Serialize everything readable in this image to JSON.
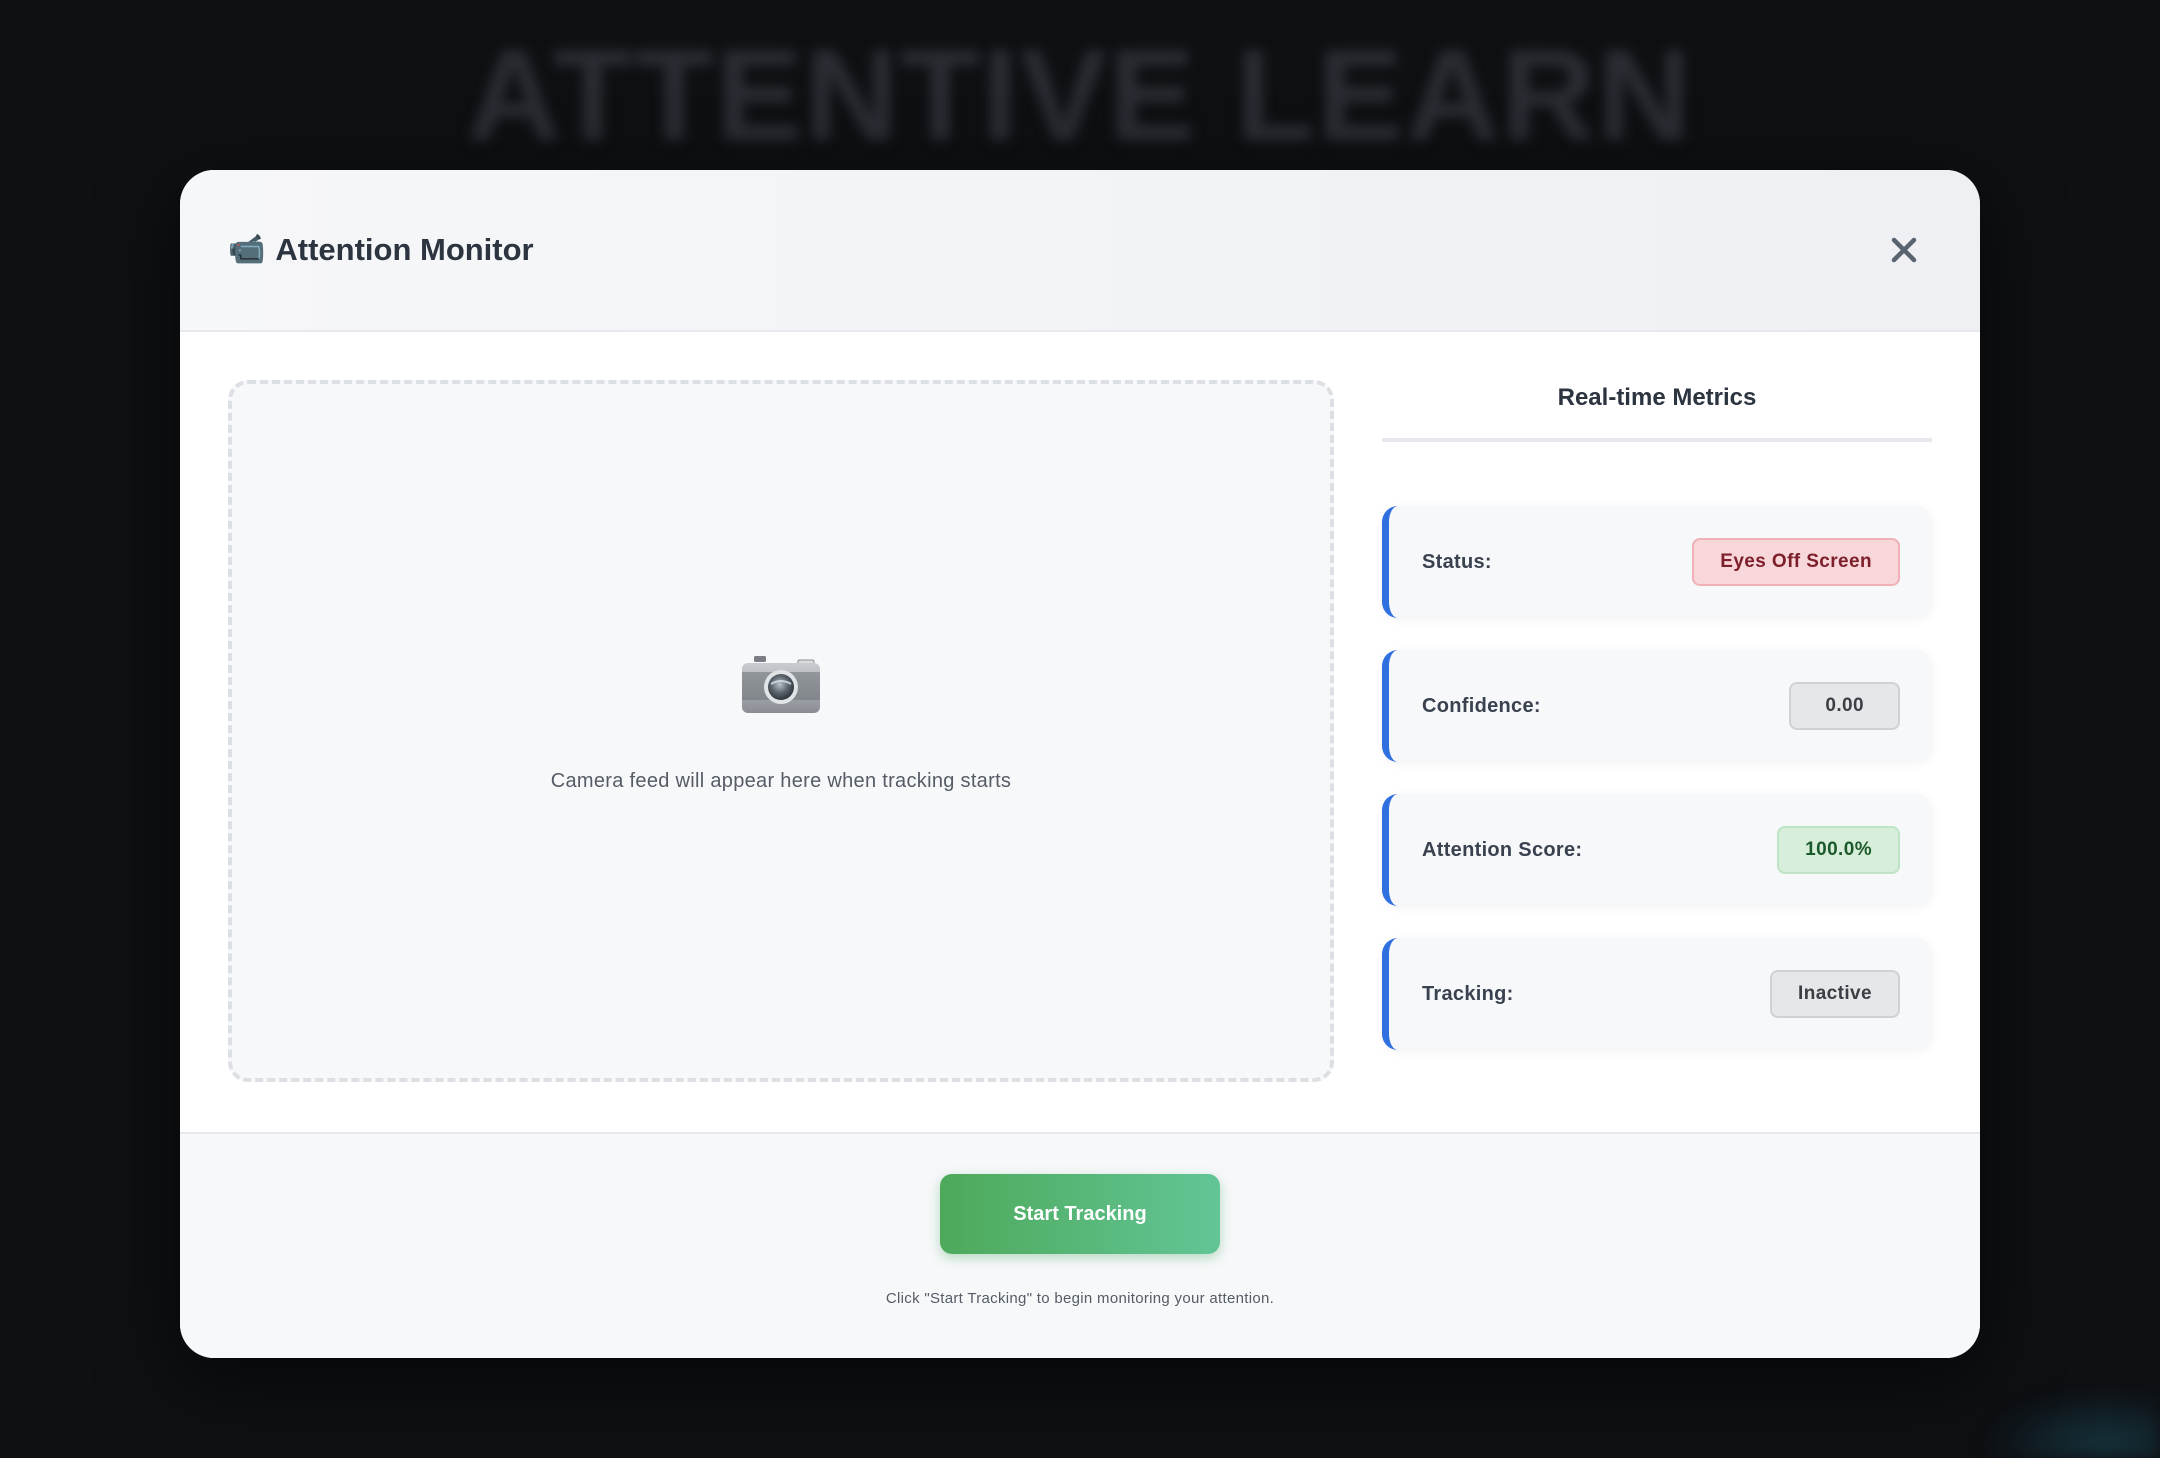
{
  "background": {
    "app_title": "ATTENTIVE LEARN"
  },
  "modal": {
    "title": "Attention Monitor",
    "title_icon": "video-camera-icon",
    "close_icon": "close-icon"
  },
  "camera": {
    "icon": "camera-icon",
    "placeholder_text": "Camera feed will appear here when tracking starts"
  },
  "metrics": {
    "title": "Real-time Metrics",
    "items": [
      {
        "label": "Status:",
        "value": "Eyes Off Screen",
        "tone": "danger"
      },
      {
        "label": "Confidence:",
        "value": "0.00",
        "tone": "neutral"
      },
      {
        "label": "Attention Score:",
        "value": "100.0%",
        "tone": "success"
      },
      {
        "label": "Tracking:",
        "value": "Inactive",
        "tone": "inactive"
      }
    ]
  },
  "footer": {
    "start_label": "Start Tracking",
    "hint": "Click \"Start Tracking\" to begin monitoring your attention."
  },
  "colors": {
    "accent_blue": "#2f6fe0",
    "button_green_start": "#4da95a",
    "button_green_end": "#62c596",
    "danger_bg": "#f8d7da",
    "success_bg": "#d7eedb"
  }
}
